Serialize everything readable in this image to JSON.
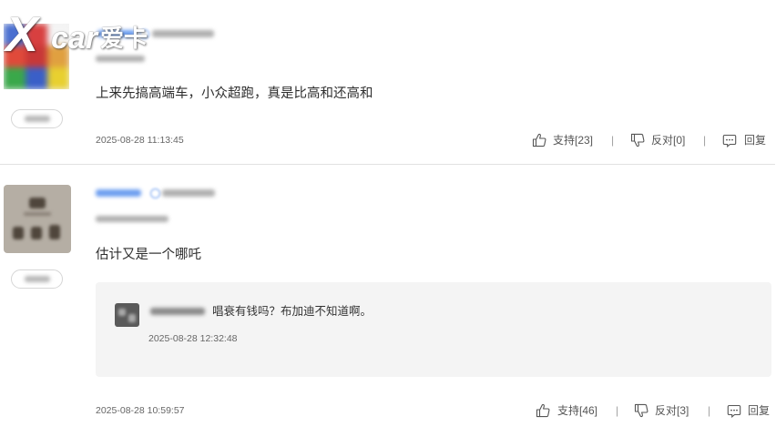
{
  "watermark": {
    "letter": "X",
    "word": "car",
    "brand_cn": "爱卡"
  },
  "comments": [
    {
      "text": "上来先搞高端车，小众超跑，真是比高和还高和",
      "time": "2025-08-28 11:13:45",
      "actions": {
        "support": "支持[23]",
        "oppose": "反对[0]",
        "reply": "回复"
      }
    },
    {
      "text": "估计又是一个哪吒",
      "reply": {
        "text": "唱衰有钱吗？布加迪不知道啊。",
        "time": "2025-08-28 12:32:48"
      },
      "time": "2025-08-28 10:59:57",
      "actions": {
        "support": "支持[46]",
        "oppose": "反对[3]",
        "reply": "回复"
      }
    }
  ],
  "separator": "|",
  "icons": {
    "support": "thumbs-up-icon",
    "oppose": "thumbs-down-icon",
    "reply": "comment-icon",
    "browser": "browser-icon"
  },
  "colors": {
    "text": "#333333",
    "meta": "#666666",
    "username": "#6d9ef0",
    "reply_bg": "#f4f4f4",
    "divider": "#e2e2e2"
  }
}
